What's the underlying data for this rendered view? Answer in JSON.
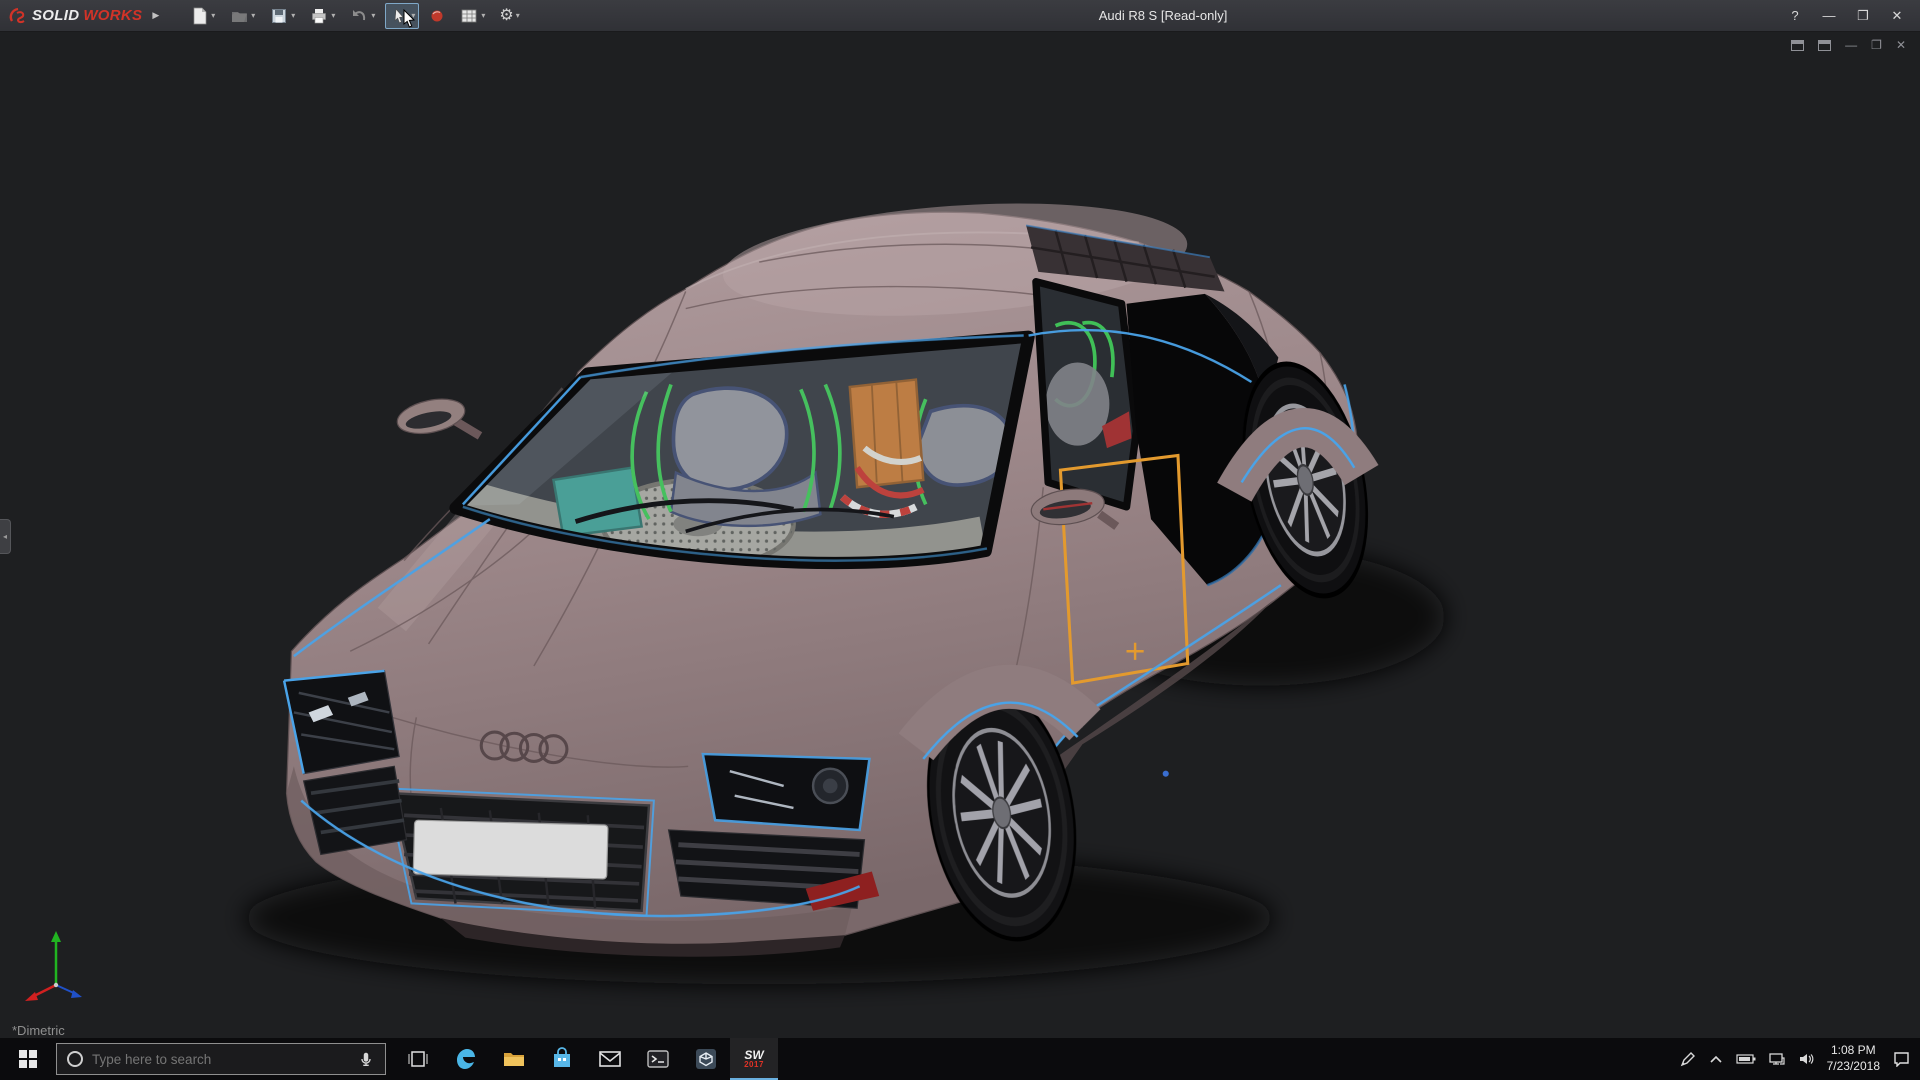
{
  "window": {
    "brand_solid": "SOLID",
    "brand_works": "WORKS",
    "expander": "▶",
    "title": "Audi R8 S [Read-only]",
    "controls": {
      "help": "?",
      "minimize": "—",
      "restore": "❐",
      "close": "✕"
    }
  },
  "toolbar": {
    "caret": "▾",
    "gear_glyph": "⚙",
    "items": [
      "new-document",
      "open",
      "save",
      "print",
      "undo",
      "select",
      "collaboration",
      "design-table",
      "options"
    ]
  },
  "viewport": {
    "orientation_label": "*Dimetric",
    "left_tab_glyph": "◂",
    "child_controls": {
      "minimize": "—",
      "restore": "❐",
      "close": "✕"
    }
  },
  "colors": {
    "selection_blue": "#4aa3e8",
    "sketch_orange": "#e39a2e",
    "cage_green": "#38c04e",
    "body_mauve": "#9a8587",
    "viewport_background": "#1e1f21"
  },
  "taskbar": {
    "search_placeholder": "Type here to search",
    "sw_letters": "SW",
    "sw_badge": "2017",
    "clock_time": "1:08 PM",
    "clock_date": "7/23/2018"
  }
}
